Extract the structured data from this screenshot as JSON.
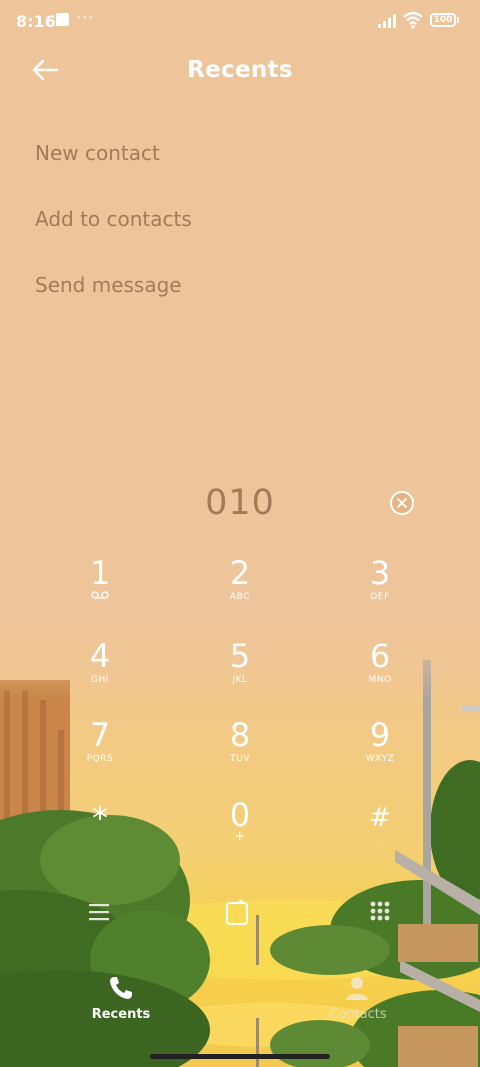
{
  "status_bar": {
    "time": "8:16",
    "battery": "100"
  },
  "header": {
    "title": "Recents"
  },
  "options": [
    "New contact",
    "Add to contacts",
    "Send message"
  ],
  "dialer": {
    "number": "010"
  },
  "keypad": [
    {
      "digit": "1",
      "letters": ""
    },
    {
      "digit": "2",
      "letters": "ABC"
    },
    {
      "digit": "3",
      "letters": "DEF"
    },
    {
      "digit": "4",
      "letters": "GHI"
    },
    {
      "digit": "5",
      "letters": "JKL"
    },
    {
      "digit": "6",
      "letters": "MNO"
    },
    {
      "digit": "7",
      "letters": "PQRS"
    },
    {
      "digit": "8",
      "letters": "TUV"
    },
    {
      "digit": "9",
      "letters": "WXYZ"
    },
    {
      "digit": "*",
      "letters": ""
    },
    {
      "digit": "0",
      "letters": "+"
    },
    {
      "digit": "#",
      "letters": ""
    }
  ],
  "bottom_nav": {
    "recents": "Recents",
    "contacts": "Contacts"
  },
  "colors": {
    "background": "#efc69b",
    "muted_text": "#a37a5a"
  }
}
